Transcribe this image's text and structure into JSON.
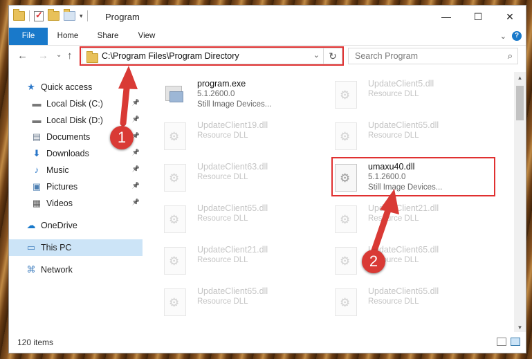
{
  "window": {
    "title": "Program",
    "controls": {
      "minimize": "—",
      "maximize": "☐",
      "close": "✕"
    }
  },
  "ribbon": {
    "tabs": [
      "File",
      "Home",
      "Share",
      "View"
    ],
    "help": "?"
  },
  "nav": {
    "back": "←",
    "forward": "→",
    "recent": "⌄",
    "up": "↑",
    "address": "C:\\Program Files\\Program Directory",
    "refresh": "↻",
    "search_placeholder": "Search Program"
  },
  "sidebar": {
    "items": [
      {
        "label": "Quick access",
        "icon": "star-icon",
        "pinned": false
      },
      {
        "label": "Local Disk (C:)",
        "icon": "drive-icon",
        "pinned": true
      },
      {
        "label": "Local Disk (D:)",
        "icon": "drive-icon",
        "pinned": true
      },
      {
        "label": "Documents",
        "icon": "documents-icon",
        "pinned": true
      },
      {
        "label": "Downloads",
        "icon": "download-icon",
        "pinned": true
      },
      {
        "label": "Music",
        "icon": "music-icon",
        "pinned": true
      },
      {
        "label": "Pictures",
        "icon": "pictures-icon",
        "pinned": true
      },
      {
        "label": "Videos",
        "icon": "videos-icon",
        "pinned": true
      },
      {
        "label": "OneDrive",
        "icon": "cloud-icon",
        "pinned": false
      },
      {
        "label": "This PC",
        "icon": "computer-icon",
        "pinned": false,
        "selected": true
      },
      {
        "label": "Network",
        "icon": "network-icon",
        "pinned": false
      }
    ]
  },
  "files": [
    {
      "name": "program.exe",
      "line2": "5.1.2600.0",
      "line3": "Still Image Devices...",
      "type": "exe"
    },
    {
      "name": "UpdateClient5.dll",
      "line2": "Resource DLL",
      "line3": "",
      "type": "dll"
    },
    {
      "name": "UpdateClient19.dll",
      "line2": "Resource DLL",
      "line3": "",
      "type": "dll"
    },
    {
      "name": "UpdateClient65.dll",
      "line2": "Resource DLL",
      "line3": "",
      "type": "dll"
    },
    {
      "name": "UpdateClient63.dll",
      "line2": "Resource DLL",
      "line3": "",
      "type": "dll"
    },
    {
      "name": "umaxu40.dll",
      "line2": "5.1.2600.0",
      "line3": "Still Image Devices...",
      "type": "dll",
      "highlighted": true
    },
    {
      "name": "UpdateClient65.dll",
      "line2": "Resource DLL",
      "line3": "",
      "type": "dll"
    },
    {
      "name": "UpdateClient21.dll",
      "line2": "Resource DLL",
      "line3": "",
      "type": "dll"
    },
    {
      "name": "UpdateClient21.dll",
      "line2": "Resource DLL",
      "line3": "",
      "type": "dll"
    },
    {
      "name": "UpdateClient65.dll",
      "line2": "Resource DLL",
      "line3": "",
      "type": "dll"
    },
    {
      "name": "UpdateClient65.dll",
      "line2": "Resource DLL",
      "line3": "",
      "type": "dll"
    },
    {
      "name": "UpdateClient65.dll",
      "line2": "Resource DLL",
      "line3": "",
      "type": "dll"
    }
  ],
  "status": {
    "count": "120 items"
  },
  "callouts": [
    {
      "label": "1"
    },
    {
      "label": "2"
    }
  ],
  "colors": {
    "accent": "#1979ca",
    "highlight": "#e03030",
    "selected": "#cce4f7"
  }
}
